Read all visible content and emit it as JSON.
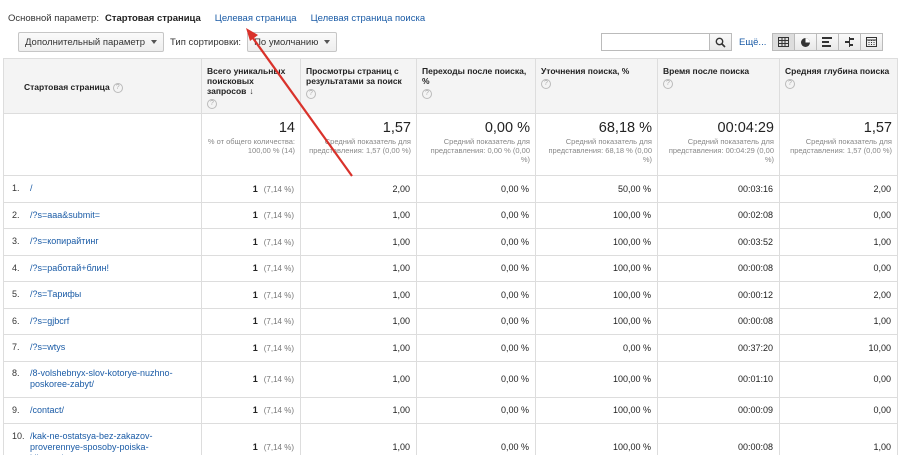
{
  "topbar": {
    "primary_label": "Основной параметр:",
    "current": "Стартовая страница",
    "links": [
      "Целевая страница",
      "Целевая страница поиска"
    ]
  },
  "toolbar": {
    "secondary_dimension": "Дополнительный параметр",
    "sort_label": "Тип сортировки:",
    "sort_value": "По умолчанию",
    "more": "Ещё..."
  },
  "table": {
    "headers": [
      "Стартовая страница",
      "Всего уникальных поисковых запросов",
      "Просмотры страниц с результатами за поиск",
      "Переходы после поиска, %",
      "Уточнения поиска, %",
      "Время после поиска",
      "Средняя глубина поиска"
    ],
    "totals": [
      {
        "big": "14",
        "sub": "% от общего количества: 100,00 % (14)"
      },
      {
        "big": "1,57",
        "sub": "Средний показатель для представления: 1,57 (0,00 %)"
      },
      {
        "big": "0,00 %",
        "sub": "Средний показатель для представления: 0,00 % (0,00 %)"
      },
      {
        "big": "68,18 %",
        "sub": "Средний показатель для представления: 68,18 % (0,00 %)"
      },
      {
        "big": "00:04:29",
        "sub": "Средний показатель для представления: 00:04:29 (0,00 %)"
      },
      {
        "big": "1,57",
        "sub": "Средний показатель для представления: 1,57 (0,00 %)"
      }
    ],
    "rows": [
      {
        "n": "1.",
        "page": "/",
        "searches": "1",
        "pct": "(7,14 %)",
        "views": "2,00",
        "exits": "0,00 %",
        "refine": "50,00 %",
        "time": "00:03:16",
        "depth": "2,00"
      },
      {
        "n": "2.",
        "page": "/?s=aaa&submit=",
        "searches": "1",
        "pct": "(7,14 %)",
        "views": "1,00",
        "exits": "0,00 %",
        "refine": "100,00 %",
        "time": "00:02:08",
        "depth": "0,00"
      },
      {
        "n": "3.",
        "page": "/?s=копирайтинг",
        "searches": "1",
        "pct": "(7,14 %)",
        "views": "1,00",
        "exits": "0,00 %",
        "refine": "100,00 %",
        "time": "00:03:52",
        "depth": "1,00"
      },
      {
        "n": "4.",
        "page": "/?s=работай+блин!",
        "searches": "1",
        "pct": "(7,14 %)",
        "views": "1,00",
        "exits": "0,00 %",
        "refine": "100,00 %",
        "time": "00:00:08",
        "depth": "0,00"
      },
      {
        "n": "5.",
        "page": "/?s=Тарифы",
        "searches": "1",
        "pct": "(7,14 %)",
        "views": "1,00",
        "exits": "0,00 %",
        "refine": "100,00 %",
        "time": "00:00:12",
        "depth": "2,00"
      },
      {
        "n": "6.",
        "page": "/?s=gjbcrf",
        "searches": "1",
        "pct": "(7,14 %)",
        "views": "1,00",
        "exits": "0,00 %",
        "refine": "100,00 %",
        "time": "00:00:08",
        "depth": "1,00"
      },
      {
        "n": "7.",
        "page": "/?s=wtys",
        "searches": "1",
        "pct": "(7,14 %)",
        "views": "1,00",
        "exits": "0,00 %",
        "refine": "0,00 %",
        "time": "00:37:20",
        "depth": "10,00"
      },
      {
        "n": "8.",
        "page": "/8-volshebnyx-slov-kotorye-nuzhno-poskoree-zabyt/",
        "searches": "1",
        "pct": "(7,14 %)",
        "views": "1,00",
        "exits": "0,00 %",
        "refine": "100,00 %",
        "time": "00:01:10",
        "depth": "0,00"
      },
      {
        "n": "9.",
        "page": "/contact/",
        "searches": "1",
        "pct": "(7,14 %)",
        "views": "1,00",
        "exits": "0,00 %",
        "refine": "100,00 %",
        "time": "00:00:09",
        "depth": "0,00"
      },
      {
        "n": "10.",
        "page": "/kak-ne-ostatsya-bez-zakazov-proverennye-sposoby-poiska-klientov/",
        "searches": "1",
        "pct": "(7,14 %)",
        "views": "1,00",
        "exits": "0,00 %",
        "refine": "100,00 %",
        "time": "00:00:08",
        "depth": "1,00"
      }
    ]
  },
  "colors": {
    "link": "#1a5ba6",
    "arrow": "#d9322b",
    "header_bg": "#f4f4f4"
  },
  "icons": [
    "search-icon",
    "grid-view-icon",
    "pie-view-icon",
    "bar-view-icon",
    "compare-view-icon",
    "pivot-view-icon",
    "help-icon",
    "sort-desc-icon"
  ]
}
